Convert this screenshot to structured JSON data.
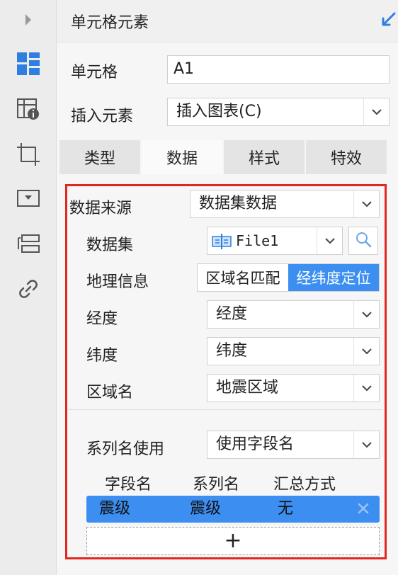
{
  "rail": {
    "icons": [
      "expand-arrow-icon",
      "cell-element-icon",
      "cell-attribute-icon",
      "float-element-icon",
      "widget-icon",
      "condition-attribute-icon",
      "hyperlink-icon"
    ]
  },
  "header": {
    "title": "单元格元素"
  },
  "cell": {
    "label": "单元格",
    "value": "A1"
  },
  "insert": {
    "label": "插入元素",
    "value": "插入图表(C)"
  },
  "tabs": [
    {
      "label": "类型",
      "active": false
    },
    {
      "label": "数据",
      "active": true
    },
    {
      "label": "样式",
      "active": false
    },
    {
      "label": "特效",
      "active": false
    }
  ],
  "data_source": {
    "label": "数据来源",
    "value": "数据集数据"
  },
  "dataset": {
    "label": "数据集",
    "value": "File1"
  },
  "geo": {
    "label": "地理信息",
    "options": [
      {
        "label": "区域名匹配",
        "active": false
      },
      {
        "label": "经纬度定位",
        "active": true
      }
    ]
  },
  "longitude": {
    "label": "经度",
    "value": "经度"
  },
  "latitude": {
    "label": "纬度",
    "value": "纬度"
  },
  "region": {
    "label": "区域名",
    "value": "地震区域"
  },
  "series_name_use": {
    "label": "系列名使用",
    "value": "使用字段名"
  },
  "table": {
    "headers": [
      "字段名",
      "系列名",
      "汇总方式"
    ],
    "rows": [
      {
        "field": "震级",
        "series": "震级",
        "summary": "无"
      }
    ],
    "add_symbol": "+"
  },
  "colors": {
    "accent": "#3c8ff0",
    "highlight_frame": "#e1271e"
  }
}
